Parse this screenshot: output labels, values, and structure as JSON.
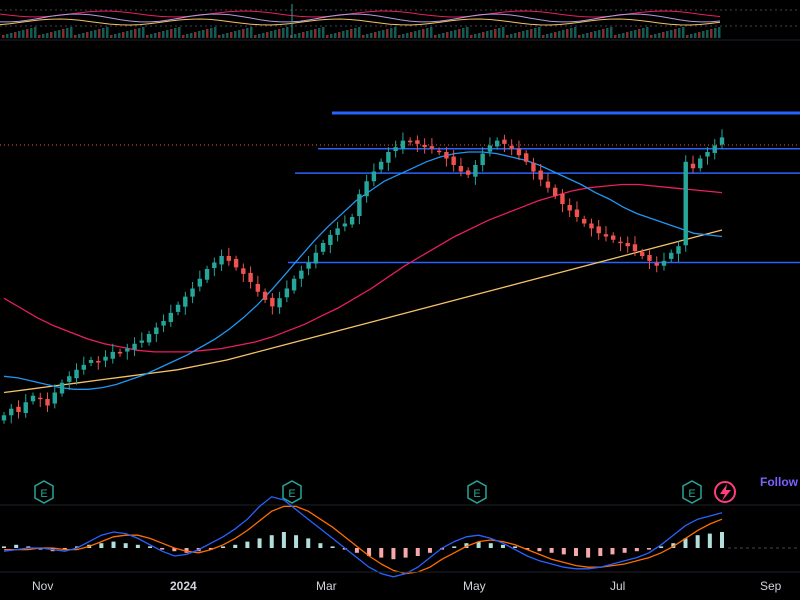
{
  "chart_data": {
    "type": "candlestick",
    "xaxis_labels": [
      "Nov",
      "2024",
      "Mar",
      "May",
      "Jul",
      "Sep"
    ],
    "earnings_marker_label": "E",
    "follow_label": "Follow",
    "colors": {
      "up": "#26a69a",
      "down": "#ef5350",
      "ma_fast": "#2196f3",
      "ma_mid": "#e91e63",
      "ma_slow": "#f5c26b",
      "level_lines": "#2962ff",
      "macd_line": "#2962ff",
      "signal_line": "#ff6d00",
      "hist_up": "#b2dfdb",
      "hist_down": "#f7a8a8",
      "background": "#000000",
      "earnings_icon": "#26a69a",
      "flash_icon": "#ff3d7f"
    },
    "price_series": [
      6,
      10,
      8,
      14,
      18,
      16,
      12,
      20,
      26,
      30,
      34,
      37,
      40,
      39,
      42,
      45,
      44,
      47,
      50,
      52,
      56,
      60,
      64,
      69,
      74,
      79,
      84,
      90,
      96,
      100,
      104,
      101,
      97,
      93,
      88,
      82,
      77,
      73,
      78,
      84,
      90,
      95,
      100,
      106,
      112,
      117,
      121,
      124,
      128,
      142,
      150,
      156,
      162,
      168,
      171,
      175,
      174,
      173,
      171,
      170,
      168,
      164,
      160,
      156,
      154,
      160,
      167,
      172,
      175,
      173,
      170,
      166,
      162,
      156,
      151,
      146,
      141,
      136,
      132,
      128,
      124,
      121,
      118,
      116,
      114,
      112,
      110,
      107,
      104,
      101,
      98,
      101,
      106,
      110,
      162,
      158,
      164,
      168,
      172,
      177
    ],
    "ma_fast": [
      30,
      29,
      27,
      25,
      23,
      22,
      22,
      23,
      25,
      28,
      31,
      35,
      39,
      43,
      48,
      53,
      59,
      66,
      74,
      83,
      93,
      103,
      113,
      122,
      130,
      138,
      144,
      150,
      154,
      158,
      162,
      165,
      167,
      168,
      168,
      167,
      165,
      163,
      160,
      156,
      152,
      148,
      143,
      139,
      134,
      130,
      127,
      124,
      121,
      118,
      117,
      116
    ],
    "ma_mid": [
      78,
      72,
      66,
      61,
      57,
      53,
      50,
      48,
      46,
      45,
      45,
      45,
      46,
      47,
      49,
      51,
      54,
      58,
      62,
      67,
      72,
      78,
      84,
      91,
      98,
      104,
      110,
      116,
      121,
      126,
      130,
      134,
      138,
      141,
      144,
      146,
      147,
      148,
      148,
      147,
      146,
      145,
      144,
      143
    ],
    "ma_slow": [
      20,
      22,
      24,
      26,
      28,
      30,
      32,
      34,
      37,
      40,
      44,
      48,
      52,
      56,
      60,
      64,
      68,
      72,
      76,
      80,
      84,
      88,
      92,
      96,
      100,
      104,
      108,
      112,
      116,
      120
    ],
    "levels": [
      192,
      170,
      155,
      100
    ],
    "macd_hist": [
      1,
      2,
      1,
      -1,
      -2,
      -1,
      1,
      2,
      3,
      4,
      3,
      2,
      1,
      -1,
      -2,
      -3,
      -2,
      -1,
      1,
      2,
      4,
      6,
      8,
      10,
      8,
      6,
      3,
      1,
      -1,
      -3,
      -5,
      -6,
      -7,
      -6,
      -5,
      -3,
      -1,
      1,
      3,
      4,
      3,
      2,
      1,
      -1,
      -2,
      -3,
      -4,
      -5,
      -6,
      -5,
      -4,
      -3,
      -2,
      -1,
      1,
      3,
      6,
      8,
      9,
      10
    ],
    "macd_line": [
      -2,
      -1,
      0,
      0,
      -1,
      -2,
      0,
      4,
      8,
      10,
      9,
      6,
      2,
      -2,
      -5,
      -4,
      -1,
      3,
      7,
      12,
      18,
      26,
      32,
      30,
      24,
      18,
      12,
      6,
      0,
      -6,
      -12,
      -16,
      -18,
      -16,
      -12,
      -6,
      0,
      4,
      7,
      8,
      6,
      3,
      -1,
      -5,
      -8,
      -10,
      -12,
      -13,
      -13,
      -12,
      -10,
      -8,
      -6,
      -3,
      2,
      8,
      14,
      18,
      20,
      22
    ],
    "signal_line": [
      -1,
      -1,
      -1,
      0,
      0,
      -1,
      -1,
      1,
      4,
      7,
      8,
      8,
      6,
      3,
      0,
      -2,
      -3,
      -1,
      2,
      6,
      11,
      17,
      23,
      26,
      26,
      23,
      18,
      13,
      7,
      1,
      -5,
      -10,
      -14,
      -16,
      -15,
      -12,
      -7,
      -3,
      1,
      4,
      5,
      4,
      2,
      -1,
      -4,
      -7,
      -9,
      -11,
      -12,
      -12,
      -11,
      -10,
      -8,
      -6,
      -3,
      1,
      6,
      11,
      15,
      18
    ]
  }
}
